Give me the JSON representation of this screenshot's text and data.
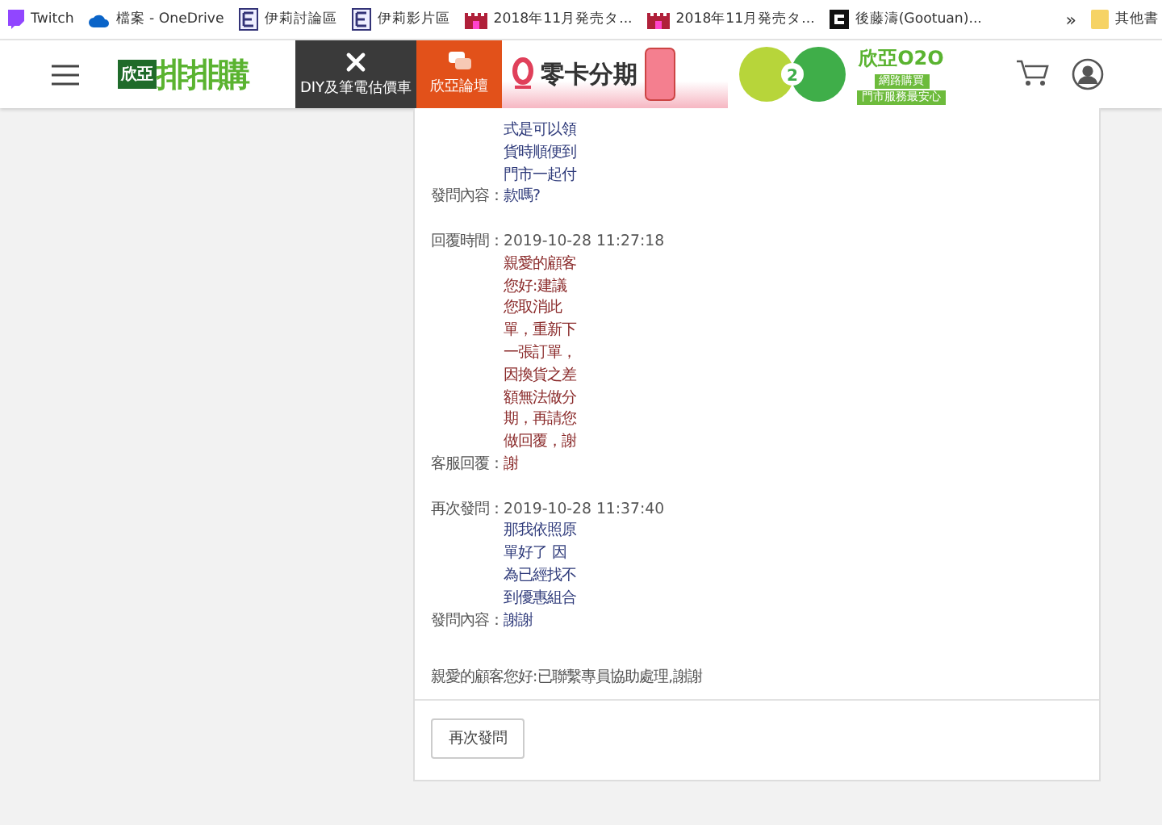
{
  "bookmarks": [
    {
      "label": "Twitch"
    },
    {
      "label": "檔案 - OneDrive"
    },
    {
      "label": "伊莉討論區"
    },
    {
      "label": "伊莉影片區"
    },
    {
      "label": "2018年11月発売タ..."
    },
    {
      "label": "2018年11月発売タ..."
    },
    {
      "label": "後藤濤(Gootuan)..."
    }
  ],
  "bookmarks_more": "»",
  "other_bookmarks": "其他書",
  "header": {
    "logo_small": "欣亞",
    "logo_big": "排排購",
    "tiles": [
      {
        "label": "DIY及筆電估價車",
        "kind": "dark"
      },
      {
        "label": "欣亞論壇",
        "kind": "orange"
      }
    ],
    "installment_banner": {
      "title": "零卡分期"
    },
    "o2o_banner": {
      "title": "欣亞O2O",
      "badge": "2",
      "lines": [
        "網路購買",
        "門市服務最安心"
      ]
    }
  },
  "groups": [
    [
      {
        "label": "發問內容：",
        "kind": "question",
        "lines": [
          "式是可以領",
          "貨時順便到",
          "門市一起付",
          "款嗎?"
        ]
      }
    ],
    [
      {
        "label": "回覆時間：",
        "kind": "time",
        "lines": [
          "2019-10-28 11:27:18"
        ]
      },
      {
        "label": "客服回覆：",
        "kind": "reply",
        "lines": [
          "親愛的顧客",
          "您好:建議",
          "您取消此",
          "單，重新下",
          "一張訂單，",
          "因換貨之差",
          "額無法做分",
          "期，再請您",
          "做回覆，謝",
          "謝"
        ]
      }
    ],
    [
      {
        "label": "再次發問：",
        "kind": "time",
        "lines": [
          "2019-10-28 11:37:40"
        ]
      },
      {
        "label": "發問內容：",
        "kind": "question",
        "lines": [
          "那我依照原",
          "單好了 因",
          "為已經找不",
          "到優惠組合",
          "謝謝"
        ]
      }
    ]
  ],
  "note": "親愛的顧客您好:已聯繫專員協助處理,謝謝",
  "button": "再次發問"
}
